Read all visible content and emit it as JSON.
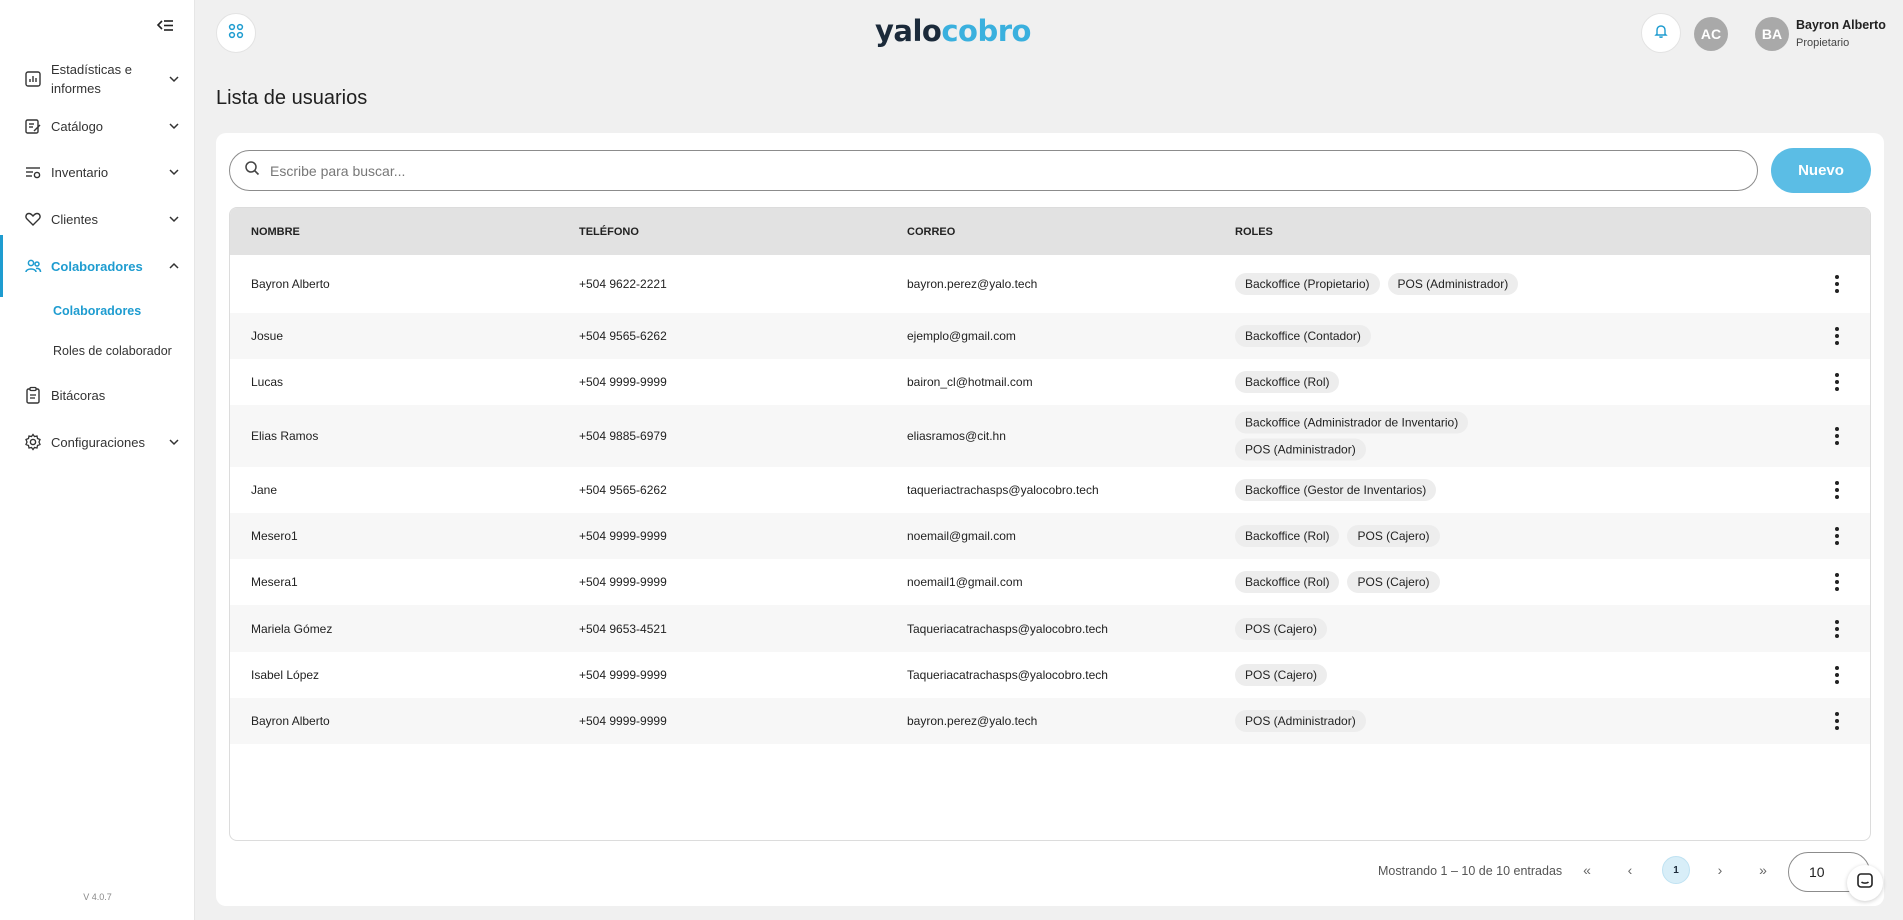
{
  "sidebar": {
    "items": [
      {
        "label": "Estadísticas e informes",
        "icon": "chart-report-icon",
        "expandable": true
      },
      {
        "label": "Catálogo",
        "icon": "catalog-edit-icon",
        "expandable": true
      },
      {
        "label": "Inventario",
        "icon": "inventory-settings-icon",
        "expandable": true
      },
      {
        "label": "Clientes",
        "icon": "heart-hand-icon",
        "expandable": true
      },
      {
        "label": "Colaboradores",
        "icon": "people-icon",
        "expandable": true,
        "active": true
      },
      {
        "label": "Bitácoras",
        "icon": "clipboard-icon",
        "expandable": false
      },
      {
        "label": "Configuraciones",
        "icon": "gear-icon",
        "expandable": true
      }
    ],
    "subitems": [
      {
        "label": "Colaboradores",
        "active": true
      },
      {
        "label": "Roles de colaborador",
        "active": false
      }
    ],
    "version": "V 4.0.7"
  },
  "header": {
    "logo_part1": "yalo",
    "logo_part2": "cobro",
    "avatar_initials": "AC",
    "user_initials": "BA",
    "user_name": "Bayron Alberto",
    "user_role": "Propietario"
  },
  "page": {
    "title": "Lista de usuarios",
    "search_placeholder": "Escribe para buscar...",
    "new_button": "Nuevo"
  },
  "table": {
    "columns": [
      "NOMBRE",
      "TELÉFONO",
      "CORREO",
      "ROLES"
    ],
    "rows": [
      {
        "name": "Bayron Alberto",
        "phone": "+504 9622-2221",
        "email": "bayron.perez@yalo.tech",
        "roles": [
          "Backoffice (Propietario)",
          "POS (Administrador)"
        ]
      },
      {
        "name": "Josue",
        "phone": "+504 9565-6262",
        "email": "ejemplo@gmail.com",
        "roles": [
          "Backoffice (Contador)"
        ]
      },
      {
        "name": "Lucas",
        "phone": "+504 9999-9999",
        "email": "bairon_cl@hotmail.com",
        "roles": [
          "Backoffice (Rol)"
        ]
      },
      {
        "name": "Elias Ramos",
        "phone": "+504 9885-6979",
        "email": "eliasramos@cit.hn",
        "roles": [
          "Backoffice (Administrador de Inventario)",
          "POS (Administrador)"
        ]
      },
      {
        "name": "Jane",
        "phone": "+504 9565-6262",
        "email": "taqueriactrachasps@yalocobro.tech",
        "roles": [
          "Backoffice (Gestor de Inventarios)"
        ]
      },
      {
        "name": "Mesero1",
        "phone": "+504 9999-9999",
        "email": "noemail@gmail.com",
        "roles": [
          "Backoffice (Rol)",
          "POS (Cajero)"
        ]
      },
      {
        "name": "Mesera1",
        "phone": "+504 9999-9999",
        "email": "noemail1@gmail.com",
        "roles": [
          "Backoffice (Rol)",
          "POS (Cajero)"
        ]
      },
      {
        "name": "Mariela Gómez",
        "phone": "+504 9653-4521",
        "email": "Taqueriacatrachasps@yalocobro.tech",
        "roles": [
          "POS (Cajero)"
        ]
      },
      {
        "name": "Isabel López",
        "phone": "+504 9999-9999",
        "email": "Taqueriacatrachasps@yalocobro.tech",
        "roles": [
          "POS (Cajero)"
        ]
      },
      {
        "name": "Bayron Alberto",
        "phone": "+504 9999-9999",
        "email": "bayron.perez@yalo.tech",
        "roles": [
          "POS (Administrador)"
        ]
      }
    ]
  },
  "pagination": {
    "info": "Mostrando 1 – 10 de 10 entradas",
    "first": "«",
    "prev": "‹",
    "current_page": "1",
    "next": "›",
    "last": "»",
    "page_size": "10"
  },
  "colors": {
    "accent": "#1e9cd0",
    "button": "#5bbde5",
    "logo_dark": "#1b2a3a",
    "logo_light": "#3ab0de"
  }
}
